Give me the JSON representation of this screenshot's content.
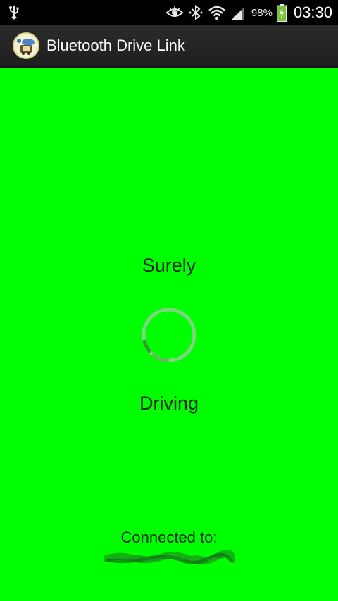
{
  "status_bar": {
    "icons": [
      "usb-icon",
      "eye-icon",
      "bluetooth-icon",
      "wifi-icon",
      "signal-icon",
      "battery-icon"
    ],
    "battery_percent": "98%",
    "time": "03:30"
  },
  "action_bar": {
    "app_icon": "app-icon",
    "title": "Bluetooth Drive Link"
  },
  "main": {
    "top_label": "Surely",
    "bottom_label": "Driving",
    "connected_label": "Connected to:"
  },
  "colors": {
    "background": "#00ff00",
    "text": "#0d2a0d",
    "spinner_track": "#7fd67f",
    "spinner_arc": "#2f9e2f"
  }
}
